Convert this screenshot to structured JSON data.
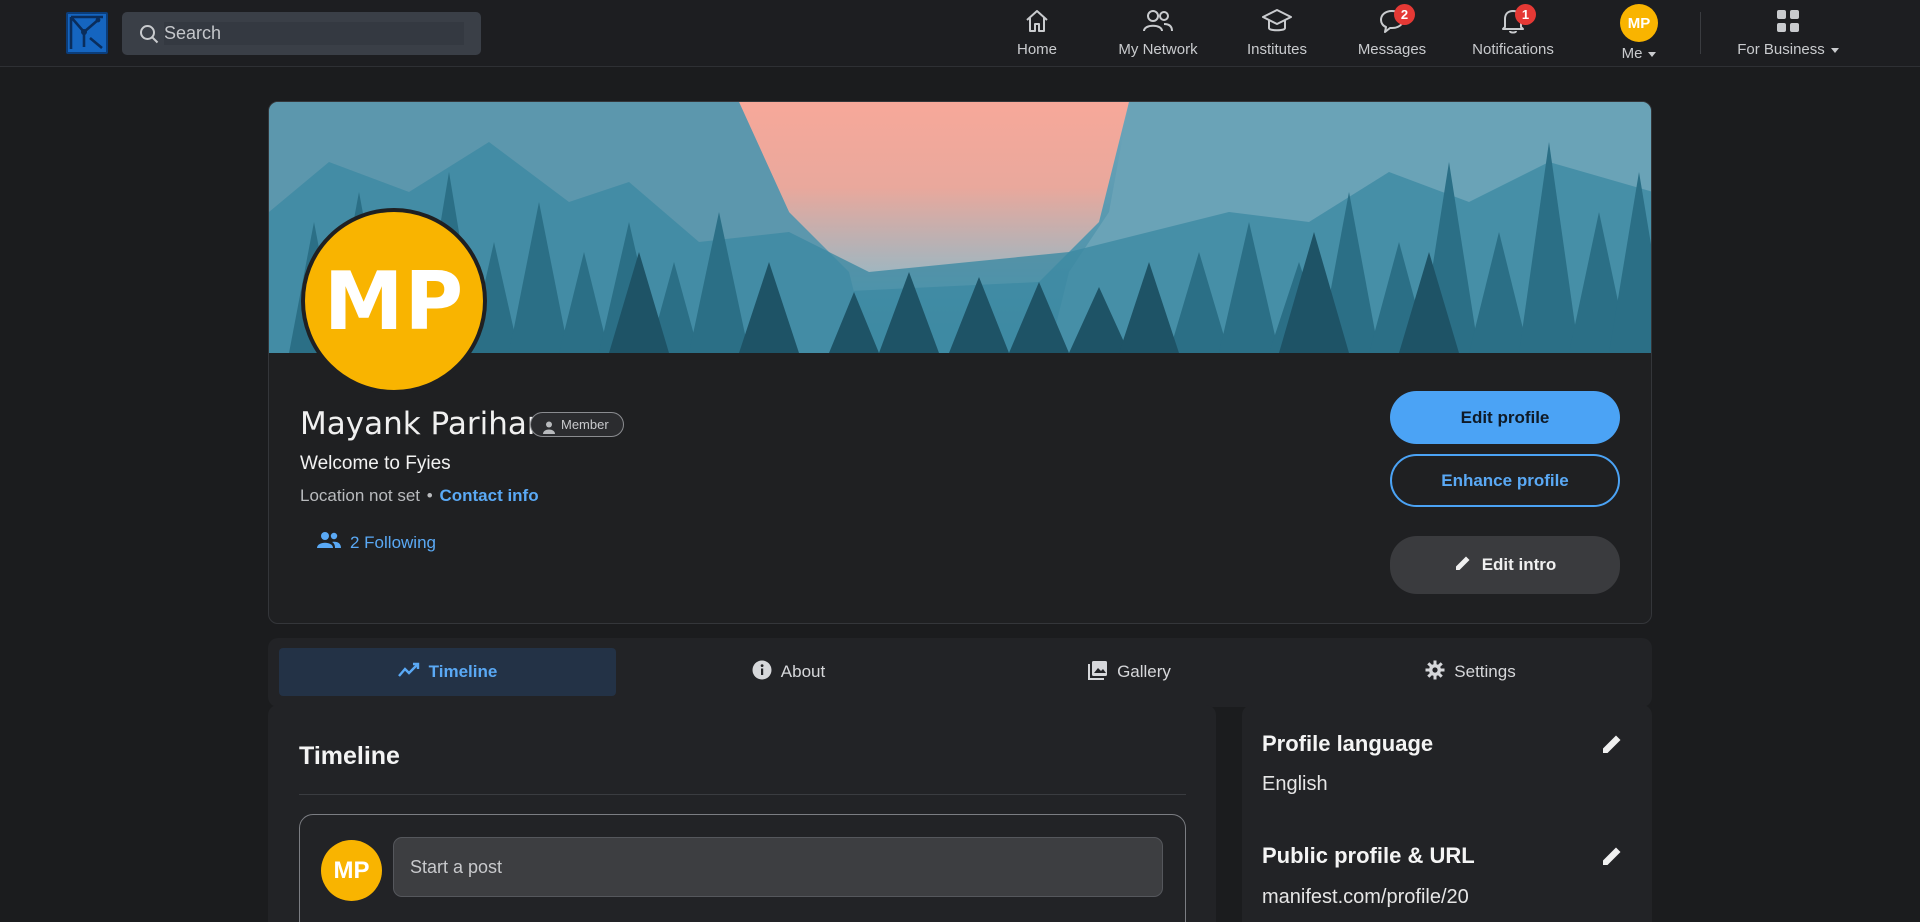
{
  "nav": {
    "search_placeholder": "Search",
    "items": [
      {
        "label": "Home",
        "icon": "home-icon"
      },
      {
        "label": "My Network",
        "icon": "people-icon"
      },
      {
        "label": "Institutes",
        "icon": "graduation-cap-icon"
      },
      {
        "label": "Messages",
        "icon": "chat-icon",
        "badge": "2"
      },
      {
        "label": "Notifications",
        "icon": "bell-icon",
        "badge": "1"
      },
      {
        "label": "Me",
        "icon": "avatar",
        "avatar_initials": "MP"
      },
      {
        "label": "For Business",
        "icon": "grid-icon"
      }
    ]
  },
  "profile": {
    "initials": "MP",
    "name": "Mayank Parihar",
    "member_badge": "Member",
    "headline": "Welcome to Fyies",
    "location": "Location not set",
    "separator": "•",
    "contact_link": "Contact info",
    "following": "2 Following"
  },
  "actions": {
    "edit_profile": "Edit profile",
    "enhance_profile": "Enhance profile",
    "edit_intro": "Edit intro"
  },
  "tabs": [
    {
      "label": "Timeline",
      "icon": "trend-icon",
      "active": true
    },
    {
      "label": "About",
      "icon": "info-icon",
      "active": false
    },
    {
      "label": "Gallery",
      "icon": "gallery-icon",
      "active": false
    },
    {
      "label": "Settings",
      "icon": "gear-icon",
      "active": false
    }
  ],
  "timeline": {
    "title": "Timeline",
    "post_placeholder": "Start a post",
    "avatar_initials": "MP"
  },
  "side": {
    "language_title": "Profile language",
    "language_value": "English",
    "url_title": "Public profile & URL",
    "url_value": "manifest.com/profile/20"
  },
  "colors": {
    "accent": "#4ba3f5",
    "avatar": "#f9b400",
    "badge": "#e53935",
    "background": "#1b1c1e"
  }
}
